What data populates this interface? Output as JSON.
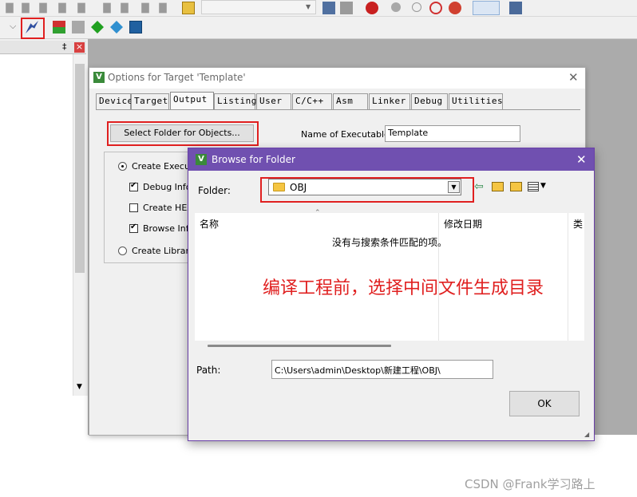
{
  "toolbar_bottom": {
    "buttons": [
      "rebuild-target",
      "options-for-target",
      "manage-components",
      "select-packs",
      "pack-installer"
    ]
  },
  "left_panel": {
    "pin_glyph": "‡",
    "close_glyph": "×"
  },
  "options_window": {
    "title": "Options for Target 'Template'",
    "tabs": [
      "Device",
      "Target",
      "Output",
      "Listing",
      "User",
      "C/C++",
      "Asm",
      "Linker",
      "Debug",
      "Utilities"
    ],
    "active_tab": "Output",
    "select_folder_label": "Select Folder for Objects...",
    "name_of_executable_label": "Name of Executable:",
    "name_of_executable_value": "Template",
    "create_executable_label": "Create Executab",
    "debug_info_label": "Debug Infor",
    "create_hex_label": "Create HEX",
    "browse_info_label": "Browse Info",
    "create_library_label": "Create Library:"
  },
  "browse_dialog": {
    "title": "Browse for Folder",
    "folder_label": "Folder:",
    "folder_value": "OBJ",
    "columns": [
      "名称",
      "修改日期",
      "类"
    ],
    "empty_message": "没有与搜索条件匹配的项。",
    "path_label": "Path:",
    "path_value": "C:\\Users\\admin\\Desktop\\新建工程\\OBJ\\",
    "ok_label": "OK"
  },
  "annotation": "编译工程前，选择中间文件生成目录",
  "watermark": "CSDN @Frank学习路上",
  "colors": {
    "annotation_red": "#e02020",
    "dialog_purple": "#7050b0"
  }
}
